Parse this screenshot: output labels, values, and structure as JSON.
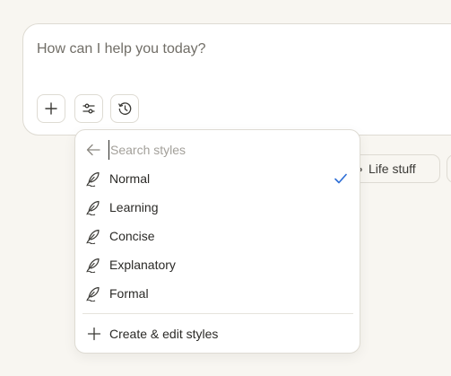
{
  "composer": {
    "placeholder": "How can I help you today?",
    "add_icon": "plus-icon",
    "tools_icon": "sliders-icon",
    "history_icon": "clock-icon"
  },
  "chips": {
    "life_stuff": {
      "label": "Life stuff",
      "icon": "coffee-cup-icon"
    }
  },
  "style_menu": {
    "back_icon": "arrow-left-icon",
    "search_placeholder": "Search styles",
    "items": [
      {
        "label": "Normal",
        "icon": "feather-icon",
        "selected": true
      },
      {
        "label": "Learning",
        "icon": "feather-icon",
        "selected": false
      },
      {
        "label": "Concise",
        "icon": "feather-icon",
        "selected": false
      },
      {
        "label": "Explanatory",
        "icon": "feather-icon",
        "selected": false
      },
      {
        "label": "Formal",
        "icon": "feather-icon",
        "selected": false
      }
    ],
    "create_label": "Create & edit styles",
    "create_icon": "plus-icon"
  },
  "colors": {
    "background": "#f8f6f1",
    "accent_check": "#2f6fd6",
    "border": "#dedbd3"
  }
}
